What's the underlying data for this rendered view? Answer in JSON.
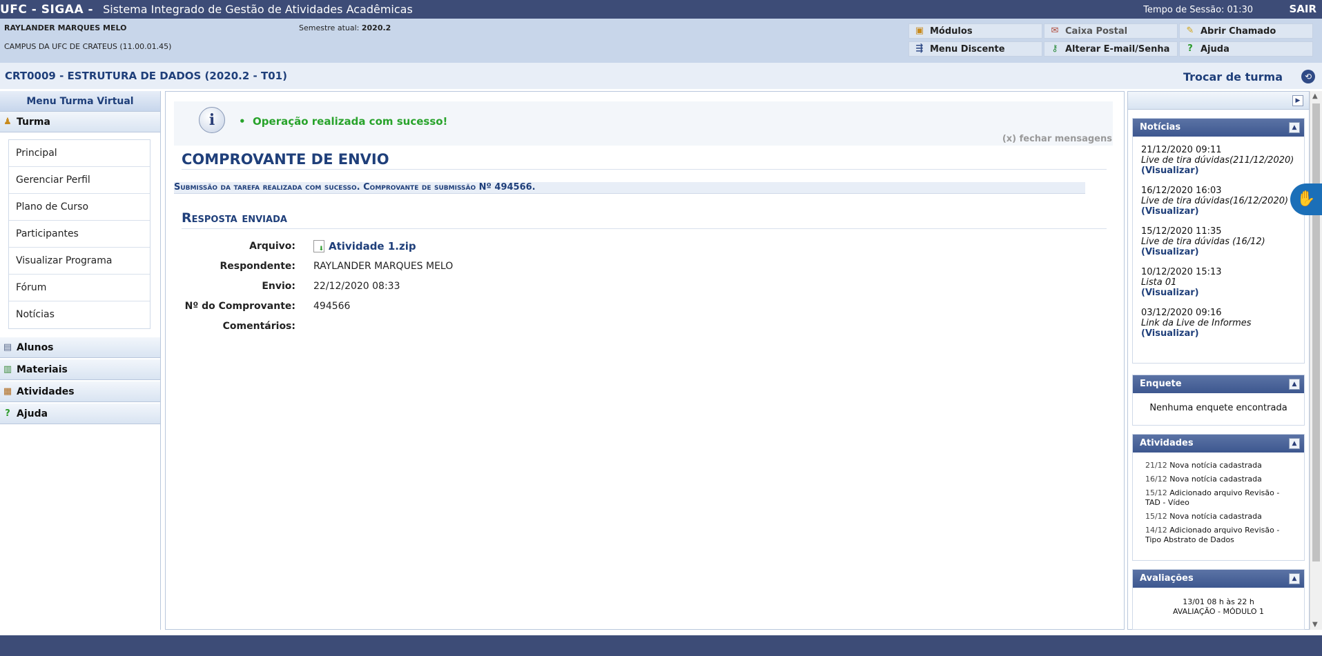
{
  "topbar": {
    "brand": "UFC - SIGAA -",
    "system_name": "Sistema Integrado de Gestão de Atividades Acadêmicas",
    "session_label": "Tempo de Sessão: 01:30",
    "logout": "SAIR"
  },
  "user": {
    "name": "RAYLANDER MARQUES MELO",
    "campus": "CAMPUS DA UFC DE CRATEUS (11.00.01.45)",
    "semester_label": "Semestre atual:",
    "semester_value": "2020.2"
  },
  "top_menu": {
    "modulos": "Módulos",
    "caixa_postal": "Caixa Postal",
    "abrir_chamado": "Abrir Chamado",
    "menu_discente": "Menu Discente",
    "alterar_email": "Alterar E-mail/Senha",
    "ajuda": "Ajuda"
  },
  "course": {
    "title": "CRT0009 - ESTRUTURA DE DADOS (2020.2 - T01)",
    "switch_label": "Trocar de turma"
  },
  "sidebar": {
    "title": "Menu Turma Virtual",
    "turma": "Turma",
    "items": [
      "Principal",
      "Gerenciar Perfil",
      "Plano de Curso",
      "Participantes",
      "Visualizar Programa",
      "Fórum",
      "Notícias"
    ],
    "alunos": "Alunos",
    "materiais": "Materiais",
    "atividades": "Atividades",
    "ajuda": "Ajuda"
  },
  "messages": {
    "success": "Operação realizada com sucesso!",
    "close": "(x) fechar mensagens"
  },
  "main": {
    "heading": "COMPROVANTE DE ENVIO",
    "subline": "Submissão da tarefa realizada com sucesso. Comprovante de submissão Nº 494566.",
    "section": "Resposta enviada",
    "fields": {
      "arquivo_label": "Arquivo:",
      "arquivo_value": "Atividade 1.zip",
      "respondente_label": "Respondente:",
      "respondente_value": "RAYLANDER MARQUES MELO",
      "envio_label": "Envio:",
      "envio_value": "22/12/2020 08:33",
      "comprovante_label": "Nº do Comprovante:",
      "comprovante_value": "494566",
      "comentarios_label": "Comentários:"
    }
  },
  "right": {
    "noticias_title": "Notícias",
    "noticias": [
      {
        "date": "21/12/2020 09:11",
        "title": "Live de tira dúvidas(211/12/2020)",
        "link": "(Visualizar)"
      },
      {
        "date": "16/12/2020 16:03",
        "title": "Live de tira dúvidas(16/12/2020)",
        "link": "(Visualizar)"
      },
      {
        "date": "15/12/2020 11:35",
        "title": "Live de tira dúvidas (16/12)",
        "link": "(Visualizar)"
      },
      {
        "date": "10/12/2020 15:13",
        "title": "Lista 01",
        "link": "(Visualizar)"
      },
      {
        "date": "03/12/2020 09:16",
        "title": "Link da Live de Informes",
        "link": "(Visualizar)"
      }
    ],
    "enquete_title": "Enquete",
    "enquete_empty": "Nenhuma enquete encontrada",
    "atividades_title": "Atividades",
    "atividades": [
      {
        "date": "21/12",
        "text": "Nova notícia cadastrada"
      },
      {
        "date": "16/12",
        "text": "Nova notícia cadastrada"
      },
      {
        "date": "15/12",
        "text": "Adicionado arquivo Revisão - TAD - Vídeo"
      },
      {
        "date": "15/12",
        "text": "Nova notícia cadastrada"
      },
      {
        "date": "14/12",
        "text": "Adicionado arquivo Revisão - Tipo Abstrato de Dados"
      }
    ],
    "avaliacoes_title": "Avaliações",
    "avaliacao_date": "13/01 08 h às 22 h",
    "avaliacao_name": "AVALIAÇÃO - MÓDULO 1"
  }
}
